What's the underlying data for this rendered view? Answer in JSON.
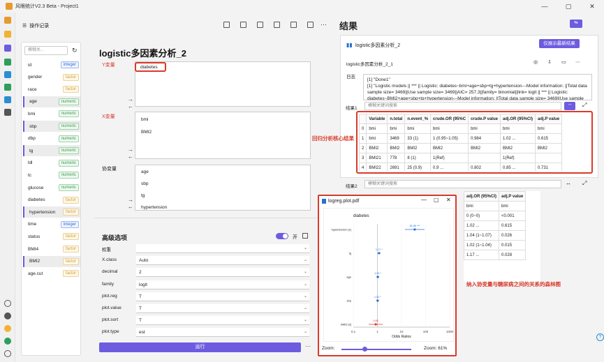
{
  "app": {
    "title": "风眼统计V2.3 Beta - Project1",
    "win_min": "—",
    "win_max": "▢",
    "win_close": "✕"
  },
  "toolbar": {
    "op_log": "操作记录",
    "more": "···"
  },
  "varpanel": {
    "search_placeholder": "模糊关...",
    "items": [
      {
        "name": "id",
        "type": "integer"
      },
      {
        "name": "gender",
        "type": "factor"
      },
      {
        "name": "race",
        "type": "factor"
      },
      {
        "name": "age",
        "type": "numeric",
        "selected": true
      },
      {
        "name": "bmi",
        "type": "numeric"
      },
      {
        "name": "sbp",
        "type": "numeric",
        "selected": true
      },
      {
        "name": "dbp",
        "type": "numeric"
      },
      {
        "name": "tg",
        "type": "numeric",
        "selected": true
      },
      {
        "name": "ldl",
        "type": "numeric"
      },
      {
        "name": "tc",
        "type": "numeric"
      },
      {
        "name": "glucose",
        "type": "numeric"
      },
      {
        "name": "diabetes",
        "type": "factor"
      },
      {
        "name": "hypertension",
        "type": "factor",
        "selected": true
      },
      {
        "name": "time",
        "type": "integer"
      },
      {
        "name": "status",
        "type": "factor"
      },
      {
        "name": "BMI4",
        "type": "factor"
      },
      {
        "name": "BMI2",
        "type": "factor",
        "selected": true
      },
      {
        "name": "age.cut",
        "type": "factor"
      }
    ]
  },
  "analysis": {
    "title": "logistic多因素分析_2",
    "y_label": "Y变量",
    "y_value": "diabetes",
    "x_label": "X变量",
    "x_values": [
      "bmi",
      "BMI2"
    ],
    "cov_label": "协变量",
    "cov_values": [
      "age",
      "sbp",
      "tg",
      "hypertension"
    ],
    "adv_title": "高级选项",
    "adv_toggle": "开",
    "options": [
      {
        "label": "权重",
        "value": ""
      },
      {
        "label": "X.class",
        "value": "Auto"
      },
      {
        "label": "decimal",
        "value": "2"
      },
      {
        "label": "family",
        "value": "logit"
      },
      {
        "label": "plot.reg",
        "value": "T"
      },
      {
        "label": "plot.value",
        "value": "T"
      },
      {
        "label": "plot.sort",
        "value": "T"
      },
      {
        "label": "plot.type",
        "value": "est"
      }
    ],
    "run": "运行",
    "run_more": "···"
  },
  "results": {
    "title": "结果",
    "card_title": "logistic多因素分析_2",
    "latest_btn": "仅展示最新结果",
    "sub_title": "logistic多因素分析_2_1",
    "log_label": "日志",
    "log_lines": [
      "[1] \"Done1\"",
      "[1] \"Logistic models  || *** || Logistic: diabetes~bmi+age+sbp+tg+hypertension---Model information: ||Total data sample size= 3469||Use sample size= 3469||AIC= 257.3||family= binomial||link= logit || *** || Logistic: diabetes~BMI2+age+sbp+tg+hypertension---Model information: ||Total data sample size= 3469||Use sample"
    ],
    "r1_label": "结果1",
    "r2_label": "结果2",
    "search_placeholder": "模糊关键词搜索",
    "table1": {
      "headers": [
        "",
        "Variable",
        "n.total",
        "n.event_%",
        "crude.OR (95%C",
        "crude.P value",
        "adj.OR (95%CI)",
        "adj.P value"
      ],
      "rows": [
        [
          "0",
          "bmi",
          "bmi",
          "bmi",
          "bmi",
          "bmi",
          "bmi",
          "bmi"
        ],
        [
          "1",
          "bmi",
          "3469",
          "33 (1)",
          "1 (0.95~1.05)",
          "0.984",
          "1.02 ...",
          "0.615"
        ],
        [
          "2",
          "BMI2",
          "BMI2",
          "BMI2",
          "BMI2",
          "BMI2",
          "BMI2",
          "BMI2"
        ],
        [
          "3",
          "BMI21",
          "778",
          "8 (1)",
          "1(Ref)",
          "",
          "1(Ref)",
          ""
        ],
        [
          "4",
          "BMI22",
          "2691",
          "25 (0.9)",
          "0.9 ...",
          "0.802",
          "0.85 ...",
          "0.731"
        ]
      ]
    },
    "table2": {
      "headers": [
        "adj.OR (95%CI)",
        "adj.P value"
      ],
      "rows": [
        [
          "bmi",
          "bmi"
        ],
        [
          "0 (0~0)",
          "<0.001"
        ],
        [
          "1.02 ...",
          "0.615"
        ],
        [
          "1.04 (1~1.07)",
          "0.026"
        ],
        [
          "1.02 (1~1.04)",
          "0.015"
        ],
        [
          "1.17 ...",
          "0.028"
        ]
      ]
    },
    "annot1": "回归分析核心结果",
    "annot2": "纳入协变量与糖尿病之间的关系的森林图"
  },
  "pdf": {
    "title": "logreg.plot.pdf",
    "plot_title": "diabetes",
    "xlabel": "Odds Ratios",
    "zoom_label": "Zoom:",
    "zoom_value": "Zoom: 61%"
  },
  "chart_data": {
    "type": "scatter",
    "title": "diabetes",
    "xlabel": "Odds Ratios",
    "ylabel": "",
    "xscale": "log",
    "x_ticks": [
      "0.1",
      "1",
      "10",
      "100",
      "1000"
    ],
    "categories": [
      "hypertension [1]",
      "tg",
      "age",
      "sbp",
      "BMI2 [2]"
    ],
    "values": [
      35.36,
      1.17,
      1.04,
      1.02,
      0.85
    ],
    "labels": [
      "35.36 ***",
      "1.17 *",
      "1.04 *",
      "1.02 *",
      "0.85"
    ],
    "colors": [
      "#2a6fd0",
      "#2a6fd0",
      "#2a6fd0",
      "#2a6fd0",
      "#d93a2a"
    ]
  },
  "colors": {
    "accent": "#6d5ce0",
    "annot": "#d93a2a"
  }
}
